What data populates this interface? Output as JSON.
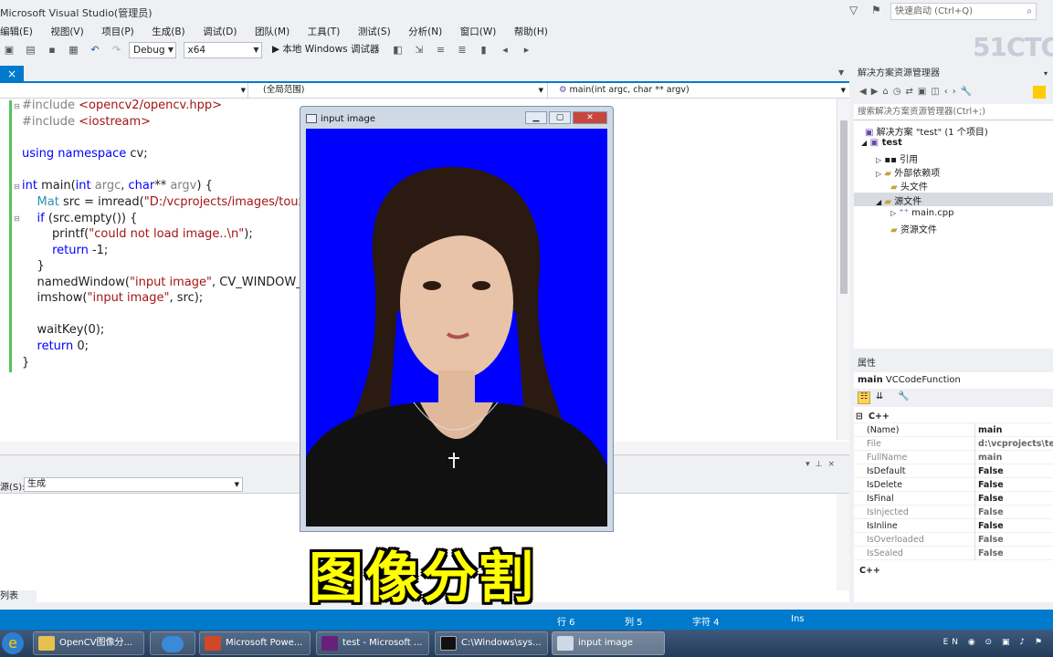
{
  "window": {
    "title": "Microsoft Visual Studio(管理员)"
  },
  "quick_launch": {
    "placeholder": "快速启动 (Ctrl+Q)"
  },
  "menu": [
    "编辑(E)",
    "视图(V)",
    "项目(P)",
    "生成(B)",
    "调试(D)",
    "团队(M)",
    "工具(T)",
    "测试(S)",
    "分析(N)",
    "窗口(W)",
    "帮助(H)"
  ],
  "toolbar": {
    "config": "Debug",
    "platform": "x64",
    "run_label": "▶ 本地 Windows 调试器"
  },
  "watermark": "51CTO",
  "doc_tab": {
    "close": "×"
  },
  "navbar": {
    "scope": "(全局范围)",
    "member": "main(int argc, char ** argv)"
  },
  "code": [
    "#include <opencv2/opencv.hpp>",
    "#include <iostream>",
    "",
    "using namespace cv;",
    "",
    "int main(int argc, char** argv) {",
    "    Mat src = imread(\"D:/vcprojects/images/toux.jp",
    "    if (src.empty()) {",
    "        printf(\"could not load image..\\n\");",
    "        return -1;",
    "    }",
    "    namedWindow(\"input image\", CV_WINDOW_A",
    "    imshow(\"input image\", src);",
    "",
    "    waitKey(0);",
    "    return 0;",
    "}"
  ],
  "output_panel": {
    "source_label": "源(S):",
    "source_value": "生成",
    "tab": "列表"
  },
  "status": {
    "row": "行 6",
    "col": "列 5",
    "char": "字符 4",
    "mode": "Ins"
  },
  "taskbar": [
    "OpenCV图像分...",
    "Microsoft Powe...",
    "test - Microsoft ...",
    "C:\\Windows\\sys...",
    "input image"
  ],
  "tray": "EN",
  "solution_explorer": {
    "title": "解决方案资源管理器",
    "search": "搜索解决方案资源管理器(Ctrl+;)",
    "items": [
      "解决方案 \"test\" (1 个项目)",
      "test",
      "引用",
      "外部依赖项",
      "头文件",
      "源文件",
      "main.cpp",
      "资源文件"
    ]
  },
  "properties": {
    "title": "属性",
    "object": "main",
    "object_type": "VCCodeFunction",
    "category": "C++",
    "rows": [
      {
        "name": "(Name)",
        "value": "main"
      },
      {
        "name": "File",
        "value": "d:\\vcprojects\\tes"
      },
      {
        "name": "FullName",
        "value": "main"
      },
      {
        "name": "IsDefault",
        "value": "False"
      },
      {
        "name": "IsDelete",
        "value": "False"
      },
      {
        "name": "IsFinal",
        "value": "False"
      },
      {
        "name": "IsInjected",
        "value": "False"
      },
      {
        "name": "IsInline",
        "value": "False"
      },
      {
        "name": "IsOverloaded",
        "value": "False"
      },
      {
        "name": "IsSealed",
        "value": "False"
      }
    ],
    "footer": "C++"
  },
  "cv_window": {
    "title": "input image"
  },
  "subtitle": "图像分割",
  "colors": {
    "accent": "#007acc",
    "image_bg": "#0000ff",
    "subtitle": "#ffff00"
  }
}
